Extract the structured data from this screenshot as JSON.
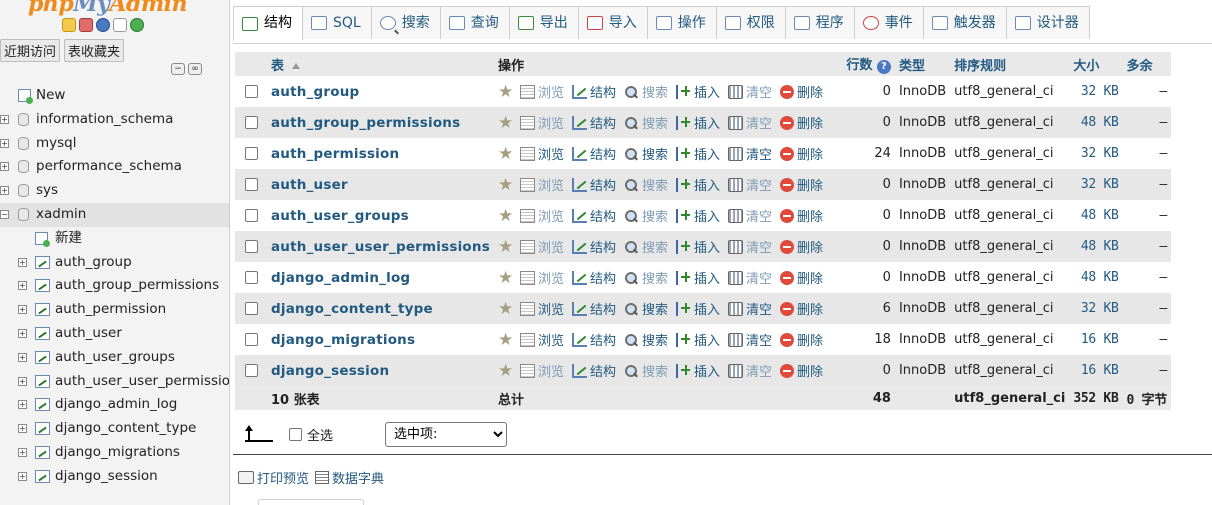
{
  "app": {
    "logo_prefix": "php",
    "logo_my": "My",
    "logo_suffix": "Admin"
  },
  "nav": {
    "tabs": [
      "近期访问",
      "表收藏夹"
    ],
    "tree": [
      {
        "label": "New",
        "kind": "new",
        "level": 0
      },
      {
        "label": "information_schema",
        "kind": "db",
        "level": 0
      },
      {
        "label": "mysql",
        "kind": "db",
        "level": 0
      },
      {
        "label": "performance_schema",
        "kind": "db",
        "level": 0
      },
      {
        "label": "sys",
        "kind": "db",
        "level": 0
      },
      {
        "label": "xadmin",
        "kind": "db",
        "level": 0,
        "expanded": true
      },
      {
        "label": "新建",
        "kind": "new",
        "level": 1
      },
      {
        "label": "auth_group",
        "kind": "table",
        "level": 1
      },
      {
        "label": "auth_group_permissions",
        "kind": "table",
        "level": 1
      },
      {
        "label": "auth_permission",
        "kind": "table",
        "level": 1
      },
      {
        "label": "auth_user",
        "kind": "table",
        "level": 1
      },
      {
        "label": "auth_user_groups",
        "kind": "table",
        "level": 1
      },
      {
        "label": "auth_user_user_permissions",
        "kind": "table",
        "level": 1
      },
      {
        "label": "django_admin_log",
        "kind": "table",
        "level": 1
      },
      {
        "label": "django_content_type",
        "kind": "table",
        "level": 1
      },
      {
        "label": "django_migrations",
        "kind": "table",
        "level": 1
      },
      {
        "label": "django_session",
        "kind": "table",
        "level": 1
      }
    ]
  },
  "top_tabs": [
    {
      "label": "结构",
      "icon": "structure-icon",
      "active": true
    },
    {
      "label": "SQL",
      "icon": "sql-icon"
    },
    {
      "label": "搜索",
      "icon": "search-icon"
    },
    {
      "label": "查询",
      "icon": "query-icon"
    },
    {
      "label": "导出",
      "icon": "export-icon"
    },
    {
      "label": "导入",
      "icon": "import-icon"
    },
    {
      "label": "操作",
      "icon": "wrench-icon"
    },
    {
      "label": "权限",
      "icon": "privileges-icon"
    },
    {
      "label": "程序",
      "icon": "routines-icon"
    },
    {
      "label": "事件",
      "icon": "clock-icon"
    },
    {
      "label": "触发器",
      "icon": "triggers-icon"
    },
    {
      "label": "设计器",
      "icon": "designer-icon"
    }
  ],
  "table": {
    "headers": {
      "table": "表",
      "action": "操作",
      "rows": "行数",
      "type": "类型",
      "collation": "排序规则",
      "size": "大小",
      "overhead": "多余"
    },
    "actions": {
      "browse": "浏览",
      "structure": "结构",
      "search": "搜索",
      "insert": "插入",
      "empty": "清空",
      "drop": "删除"
    },
    "rows": [
      {
        "name": "auth_group",
        "rows": "0",
        "type": "InnoDB",
        "collation": "utf8_general_ci",
        "size": "32 KB",
        "overhead": "–"
      },
      {
        "name": "auth_group_permissions",
        "rows": "0",
        "type": "InnoDB",
        "collation": "utf8_general_ci",
        "size": "48 KB",
        "overhead": "–"
      },
      {
        "name": "auth_permission",
        "rows": "24",
        "type": "InnoDB",
        "collation": "utf8_general_ci",
        "size": "32 KB",
        "overhead": "–"
      },
      {
        "name": "auth_user",
        "rows": "0",
        "type": "InnoDB",
        "collation": "utf8_general_ci",
        "size": "32 KB",
        "overhead": "–"
      },
      {
        "name": "auth_user_groups",
        "rows": "0",
        "type": "InnoDB",
        "collation": "utf8_general_ci",
        "size": "48 KB",
        "overhead": "–"
      },
      {
        "name": "auth_user_user_permissions",
        "rows": "0",
        "type": "InnoDB",
        "collation": "utf8_general_ci",
        "size": "48 KB",
        "overhead": "–"
      },
      {
        "name": "django_admin_log",
        "rows": "0",
        "type": "InnoDB",
        "collation": "utf8_general_ci",
        "size": "48 KB",
        "overhead": "–"
      },
      {
        "name": "django_content_type",
        "rows": "6",
        "type": "InnoDB",
        "collation": "utf8_general_ci",
        "size": "32 KB",
        "overhead": "–"
      },
      {
        "name": "django_migrations",
        "rows": "18",
        "type": "InnoDB",
        "collation": "utf8_general_ci",
        "size": "16 KB",
        "overhead": "–"
      },
      {
        "name": "django_session",
        "rows": "0",
        "type": "InnoDB",
        "collation": "utf8_general_ci",
        "size": "16 KB",
        "overhead": "–"
      }
    ],
    "footer": {
      "count": "10 张表",
      "total_label": "总计",
      "rows": "48",
      "collation": "utf8_general_ci",
      "size": "352 KB",
      "overhead": "0 字节"
    }
  },
  "bulk": {
    "select_all": "全选",
    "with_selected": "选中项:"
  },
  "footer_links": {
    "print": "打印预览",
    "dict": "数据字典"
  }
}
